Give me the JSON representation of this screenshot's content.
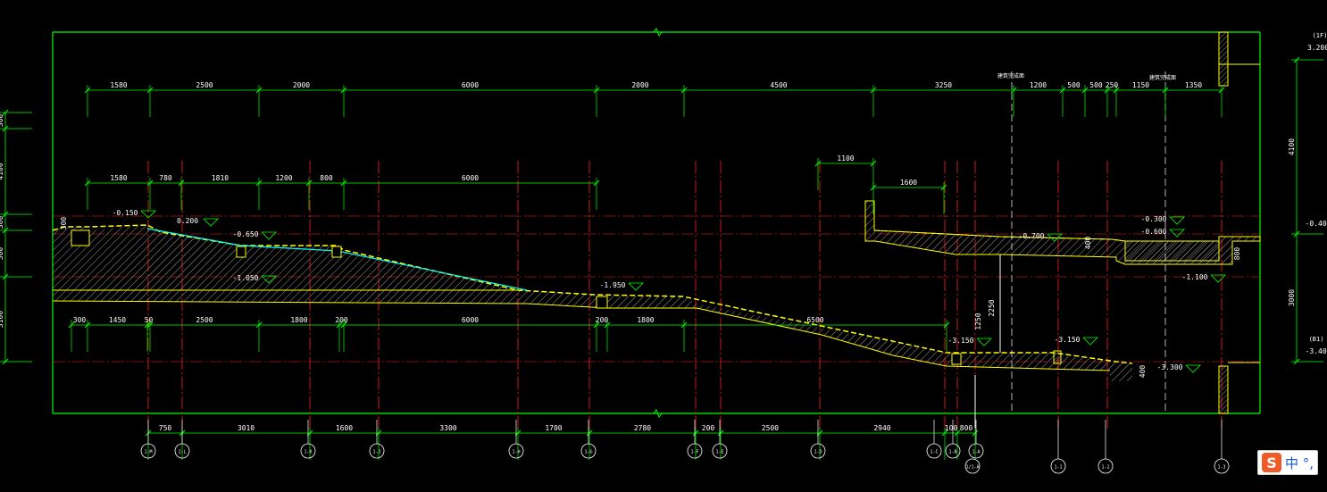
{
  "colors": {
    "background": "#000000",
    "frame": "#00ff00",
    "dimension": "#ffffff",
    "axis": "#ff0000",
    "concrete_outline": "#ffff00",
    "hatch": "#bbbbbb",
    "waterproof": "#00ffff",
    "label": "#ffffff"
  },
  "dims_top_row1": [
    "1580",
    "2500",
    "2000",
    "6000",
    "2000",
    "4500",
    "3250",
    "1200",
    "500",
    "500",
    "250",
    "1150",
    "1350"
  ],
  "dims_top_row2": [
    "1580",
    "780",
    "1810",
    "1200",
    "800",
    "6000"
  ],
  "dims_upper_right": [
    "1100",
    "1600"
  ],
  "dims_bottom_row": [
    "300",
    "1450",
    "50",
    "2500",
    "1800",
    "200",
    "6000",
    "200",
    "1800",
    "6500"
  ],
  "dims_axis_row": [
    "750",
    "3010",
    "1600",
    "3300",
    "1700",
    "2780",
    "200",
    "2500",
    "2940",
    "100",
    "800"
  ],
  "dims_left": [
    "300",
    "4100",
    "300",
    "300",
    "3100"
  ],
  "dims_right": [
    "4100",
    "3000"
  ],
  "dims_misc": [
    "1250",
    "2250",
    "400",
    "800",
    "300",
    "400"
  ],
  "elevations": [
    "-0.150",
    "0.200",
    "-0.650",
    "-1.050",
    "-1.950",
    "-3.150",
    "-3.150",
    "-3.300",
    "-0.700",
    "-0.300",
    "-0.600",
    "-1.100",
    "-0.400",
    "-3.400",
    "3.200"
  ],
  "right_labels": [
    "(1F)",
    "(B1)"
  ],
  "notes": [
    "建筑完成面",
    "建筑完成面"
  ],
  "axis_labels": [
    "1-M",
    "1-L",
    "1-K",
    "1-J",
    "1-H",
    "1-G",
    "1-F",
    "1-E",
    "1-D",
    "1-C",
    "1-B",
    "1-A",
    "1/1-A",
    "1-1",
    "1-2",
    "1-3"
  ],
  "ime": {
    "logo": "S",
    "text": "中 °,"
  }
}
